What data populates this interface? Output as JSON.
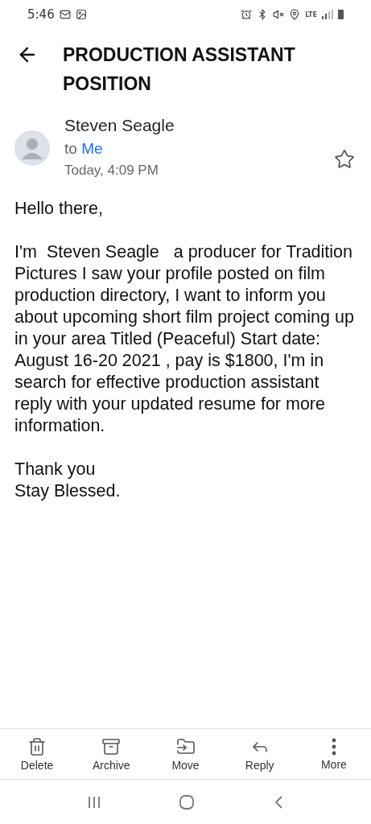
{
  "status_bar": {
    "time": "5:46",
    "network": "LTE"
  },
  "header": {
    "title": "PRODUCTION ASSISTANT POSITION"
  },
  "message": {
    "sender": "Steven Seagle",
    "to_label": "to",
    "recipient": "Me",
    "date": "Today, 4:09 PM",
    "starred": false
  },
  "body": [
    {
      "kind": "greeting",
      "text": "Hello there,"
    },
    {
      "kind": "paragraph",
      "text": "I'm  Steven Seagle   a producer for Tradition Pictures I saw your profile posted on film production directory, I want to inform you about upcoming short film project coming up in your area Titled (Peaceful) Start date: August 16-20 2021 , pay is $1800, I'm in search for effective production assistant reply with your updated resume for more information."
    },
    {
      "kind": "signoff",
      "lines": [
        "Thank you",
        "Stay Blessed."
      ]
    }
  ],
  "toolbar": [
    {
      "kind": "delete",
      "label": "Delete"
    },
    {
      "kind": "archive",
      "label": "Archive"
    },
    {
      "kind": "move",
      "label": "Move"
    },
    {
      "kind": "reply",
      "label": "Reply"
    },
    {
      "kind": "more",
      "label": "More"
    }
  ]
}
